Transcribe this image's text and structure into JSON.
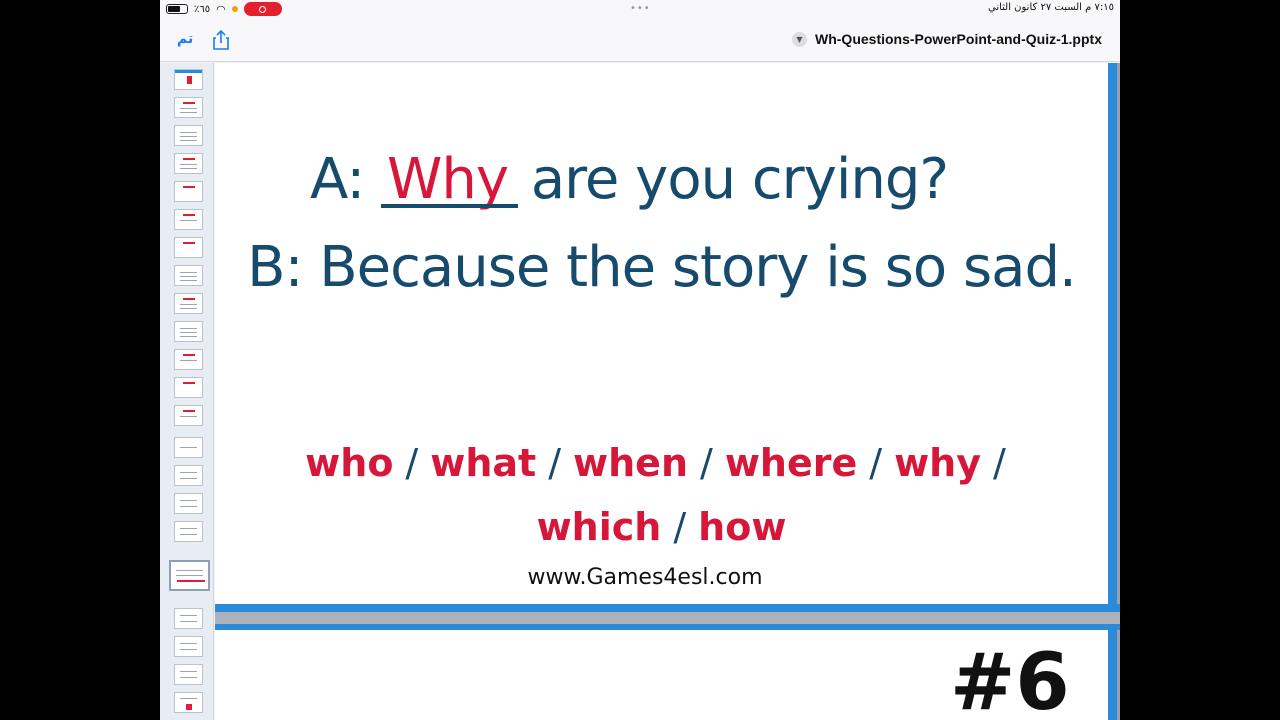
{
  "status": {
    "battery": "٪٦٥",
    "time_date": "٧:١٥ م   السبت ٢٧ كانون الثاني"
  },
  "nav": {
    "done_label": "تم",
    "doc_title": "Wh-Questions-PowerPoint-and-Quiz-1.pptx"
  },
  "slide": {
    "line_a_prefix": "A: ",
    "answer": "Why",
    "line_a_suffix": " are you crying?",
    "line_b": "B: Because the story is so sad.",
    "choices": [
      "who",
      "what",
      "when",
      "where",
      "why",
      "which",
      "how"
    ],
    "separator": "/",
    "website": "www.Games4esl.com"
  },
  "next_slide": {
    "number": "#6"
  },
  "colors": {
    "answer_red": "#d7173a",
    "text_blue": "#174b6e",
    "accent_blue": "#2b8bd8",
    "ios_blue": "#1a7cf0"
  }
}
